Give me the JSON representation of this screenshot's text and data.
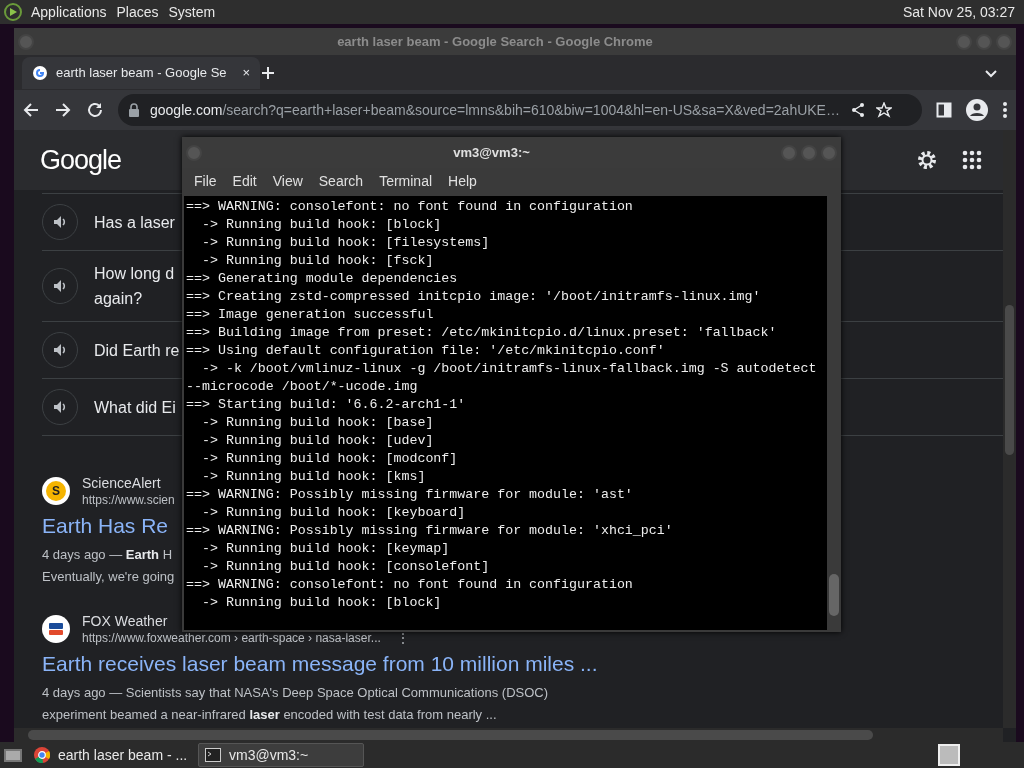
{
  "top_panel": {
    "menus": [
      "Applications",
      "Places",
      "System"
    ],
    "clock": "Sat Nov 25, 03:27"
  },
  "browser": {
    "title": "earth laser beam - Google Search - Google Chrome",
    "tabs": [
      {
        "label": "earth laser beam - Google Se",
        "close": "×",
        "selected": true
      }
    ],
    "address": {
      "domain": "google.com",
      "path": "/search?q=earth+laser+beam&source=lmns&bih=610&biw=1004&hl=en-US&sa=X&ved=2ahUKE…"
    },
    "logo": "Google",
    "questions": [
      {
        "lines": [
          "Has a laser"
        ]
      },
      {
        "lines": [
          "How long d",
          "again?"
        ]
      },
      {
        "lines": [
          "Did Earth re"
        ]
      },
      {
        "lines": [
          "What did Ei"
        ]
      }
    ],
    "results": [
      {
        "kind": "letter",
        "badge": "S",
        "source": "ScienceAlert",
        "url": "https://www.scien",
        "title": "Earth Has Re",
        "snippet": [
          "4 days ago — **Earth** H",
          "Eventually, we're going"
        ]
      },
      {
        "kind": "fox",
        "source": "FOX Weather",
        "url": "https://www.foxweather.com › earth-space › nasa-laser...",
        "menu": "⋮",
        "title": "Earth receives laser beam message from 10 million miles ...",
        "snippet": [
          "4 days ago — Scientists say that NASA's Deep Space Optical Communications (DSOC)",
          "experiment beamed a near-infrared **laser** encoded with test data from nearly ..."
        ]
      }
    ]
  },
  "terminal": {
    "title": "vm3@vm3:~",
    "menus": [
      "File",
      "Edit",
      "View",
      "Search",
      "Terminal",
      "Help"
    ],
    "lines": [
      "==> WARNING: consolefont: no font found in configuration",
      "  -> Running build hook: [block]",
      "  -> Running build hook: [filesystems]",
      "  -> Running build hook: [fsck]",
      "==> Generating module dependencies",
      "==> Creating zstd-compressed initcpio image: '/boot/initramfs-linux.img'",
      "==> Image generation successful",
      "==> Building image from preset: /etc/mkinitcpio.d/linux.preset: 'fallback'",
      "==> Using default configuration file: '/etc/mkinitcpio.conf'",
      "  -> -k /boot/vmlinuz-linux -g /boot/initramfs-linux-fallback.img -S autodetect",
      "--microcode /boot/*-ucode.img",
      "==> Starting build: '6.6.2-arch1-1'",
      "  -> Running build hook: [base]",
      "  -> Running build hook: [udev]",
      "  -> Running build hook: [modconf]",
      "  -> Running build hook: [kms]",
      "==> WARNING: Possibly missing firmware for module: 'ast'",
      "  -> Running build hook: [keyboard]",
      "==> WARNING: Possibly missing firmware for module: 'xhci_pci'",
      "  -> Running build hook: [keymap]",
      "  -> Running build hook: [consolefont]",
      "==> WARNING: consolefont: no font found in configuration",
      "  -> Running build hook: [block]"
    ]
  },
  "taskbar": {
    "items": [
      {
        "kind": "browser",
        "label": "earth laser beam - ...",
        "selected": false
      },
      {
        "kind": "terminal",
        "label": "vm3@vm3:~",
        "selected": true
      }
    ]
  }
}
